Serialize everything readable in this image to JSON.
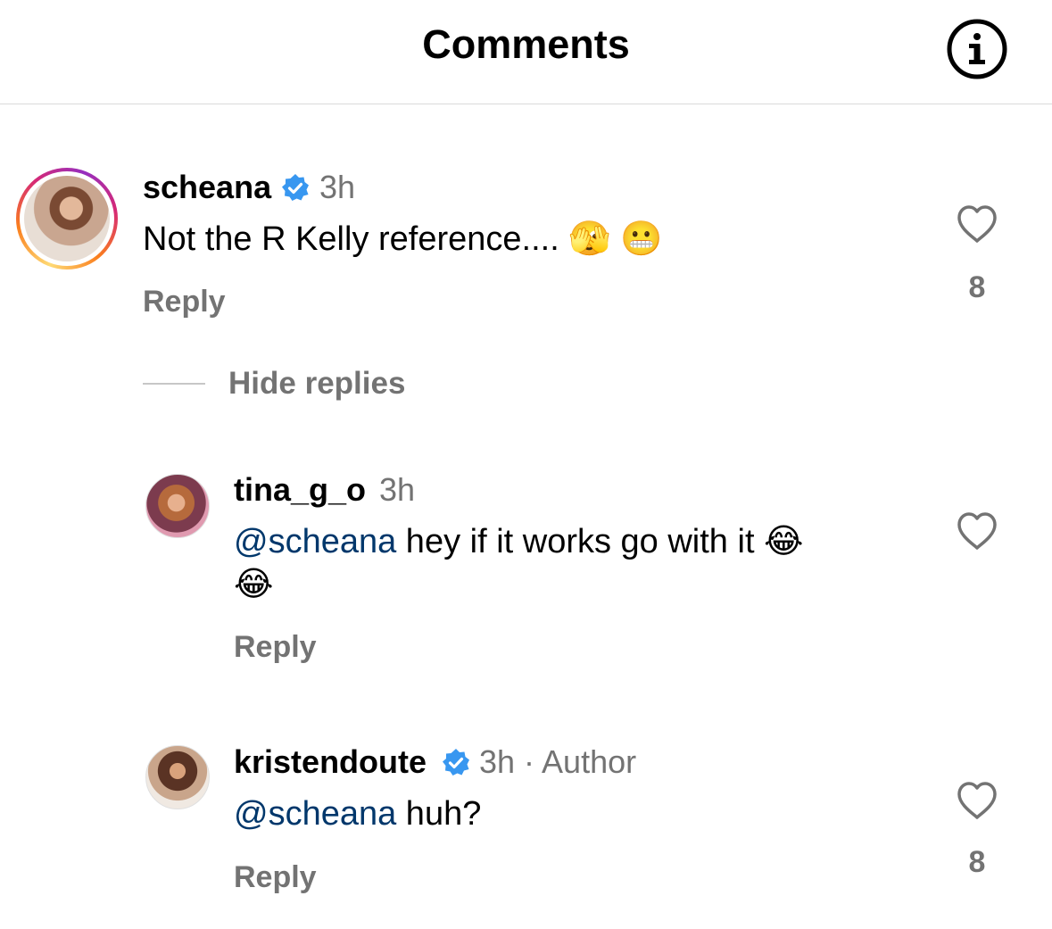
{
  "header": {
    "title": "Comments",
    "info_icon": "info-icon"
  },
  "comments": [
    {
      "username": "scheana",
      "verified": true,
      "time": "3h",
      "text": "Not the R Kelly reference.... 🫣 😬",
      "reply_label": "Reply",
      "likes": "8"
    }
  ],
  "hide_replies_label": "Hide replies",
  "replies": [
    {
      "username": "tina_g_o",
      "verified": false,
      "time": "3h",
      "mention": "@scheana",
      "text_line1": " hey if it works go with it 😂",
      "text_line2": "😂",
      "reply_label": "Reply",
      "likes": ""
    },
    {
      "username": "kristendoute",
      "verified": true,
      "time": "3h · Author",
      "mention": "@scheana",
      "text_line1": " huh?",
      "reply_label": "Reply",
      "likes": "8"
    }
  ],
  "colors": {
    "verified_blue": "#3897f0",
    "secondary_text": "#737373",
    "mention": "#00376b"
  }
}
